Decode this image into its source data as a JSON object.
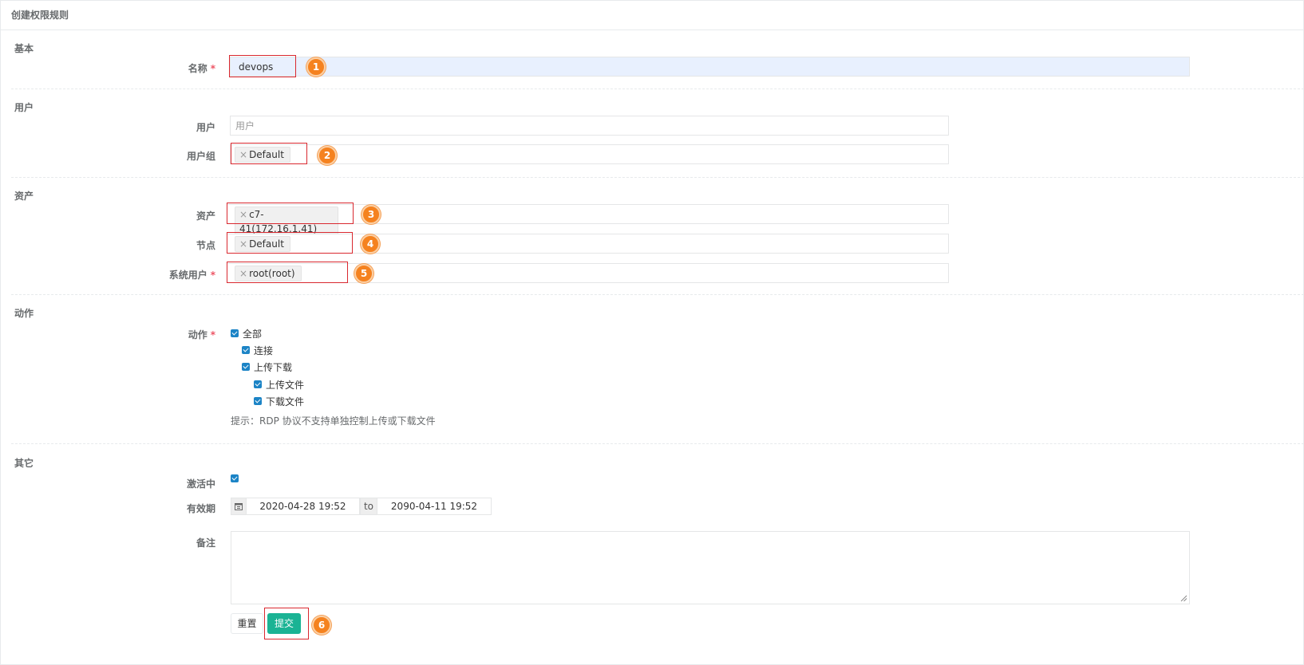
{
  "page": {
    "title": "创建权限规则"
  },
  "sections": {
    "basic": "基本",
    "users": "用户",
    "assets": "资产",
    "actions": "动作",
    "other": "其它"
  },
  "fields": {
    "name": {
      "label": "名称",
      "required": "*",
      "value": "devops"
    },
    "user": {
      "label": "用户",
      "placeholder": "用户"
    },
    "user_group": {
      "label": "用户组",
      "tag": "Default"
    },
    "asset": {
      "label": "资产",
      "tag": "c7-41(172.16.1.41)"
    },
    "node": {
      "label": "节点",
      "tag": "Default"
    },
    "system_user": {
      "label": "系统用户",
      "required": "*",
      "tag": "root(root)"
    },
    "actions": {
      "label": "动作",
      "required": "*",
      "all": "全部",
      "connect": "连接",
      "updown": "上传下载",
      "upload": "上传文件",
      "download": "下载文件",
      "hint": "提示：RDP 协议不支持单独控制上传或下载文件"
    },
    "active": {
      "label": "激活中"
    },
    "validity": {
      "label": "有效期",
      "start": "2020-04-28 19:52",
      "to": "to",
      "end": "2090-04-11 19:52"
    },
    "comment": {
      "label": "备注"
    }
  },
  "tag_remove": "×",
  "buttons": {
    "reset": "重置",
    "submit": "提交"
  },
  "badges": [
    "1",
    "2",
    "3",
    "4",
    "5",
    "6"
  ],
  "colors": {
    "primary": "#1ab394",
    "checkbox": "#1c84c6",
    "required": "#ed5565",
    "highlight_box": "#d9282f",
    "badge": "#f5821f"
  },
  "icons": {
    "calendar": "calendar-icon"
  }
}
